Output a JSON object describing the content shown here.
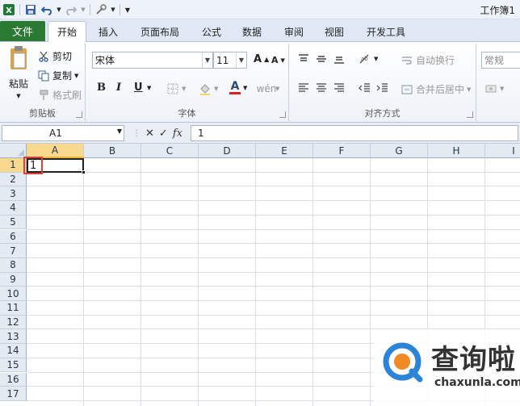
{
  "window": {
    "title": "工作簿1"
  },
  "ribbon_tabs": [
    {
      "label": "文件"
    },
    {
      "label": "开始"
    },
    {
      "label": "插入"
    },
    {
      "label": "页面布局"
    },
    {
      "label": "公式"
    },
    {
      "label": "数据"
    },
    {
      "label": "审阅"
    },
    {
      "label": "视图"
    },
    {
      "label": "开发工具"
    }
  ],
  "clipboard": {
    "paste": "粘贴",
    "cut": "剪切",
    "copy": "复制",
    "format_painter": "格式刷",
    "group_label": "剪贴板"
  },
  "font": {
    "name": "宋体",
    "size": "11",
    "bold": "B",
    "italic": "I",
    "underline": "U",
    "font_color_glyph": "A",
    "group_label": "字体"
  },
  "alignment": {
    "wrap_text": "自动换行",
    "merge_center": "合并后居中",
    "group_label": "对齐方式"
  },
  "number": {
    "format": "常规"
  },
  "formula_bar": {
    "name_box": "A1",
    "fx": "fx",
    "value": "1"
  },
  "grid": {
    "columns": [
      "A",
      "B",
      "C",
      "D",
      "E",
      "F",
      "G",
      "H",
      "I"
    ],
    "rows": [
      "1",
      "2",
      "3",
      "4",
      "5",
      "6",
      "7",
      "8",
      "9",
      "10",
      "11",
      "12",
      "13",
      "14",
      "15",
      "16",
      "17"
    ],
    "selected_column": "A",
    "selected_row": "1",
    "cell_a1": "1"
  },
  "watermark": {
    "name": "查询啦",
    "url": "chaxunla.com"
  },
  "colors": {
    "file_tab": "#2a7a34",
    "selection_header": "#f9d98d",
    "highlight_box": "#e0403a",
    "watermark_blue": "#2b84d8",
    "watermark_orange": "#f08a24"
  }
}
